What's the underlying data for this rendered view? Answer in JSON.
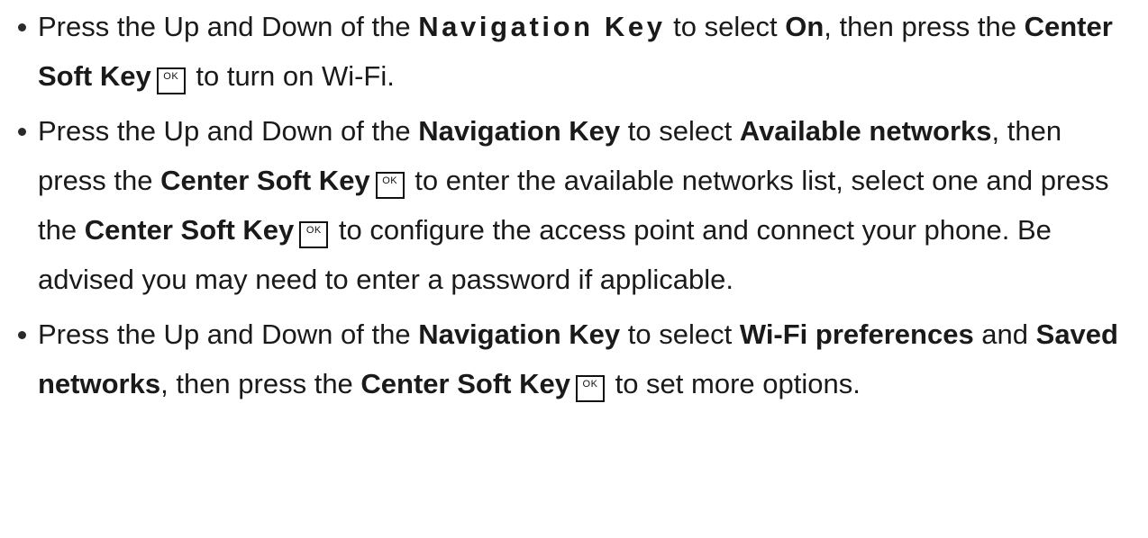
{
  "ok_key_label": "OK",
  "bullets": [
    {
      "p1": "Press the Up and Down of the ",
      "b1": "Navigation Key",
      "p2": " to select ",
      "b2": "On",
      "p3": ", then press the ",
      "b3": "Center Soft Key",
      "p4": " to turn on Wi-Fi."
    },
    {
      "p1": "Press the Up and Down of the ",
      "b1": "Navigation Key",
      "p2": " to select ",
      "b2": "Available networks",
      "p3": ", then press the ",
      "b3": "Center Soft Key",
      "p4": " to enter the available networks list, select one and press the ",
      "b4": "Center Soft Key",
      "p5": " to configure the access point and connect your phone. Be advised you may need to enter a password if applicable."
    },
    {
      "p1": "Press the Up and Down of the ",
      "b1": "Navigation Key",
      "p2": " to select ",
      "b2": "Wi-Fi preferences",
      "p3": " and ",
      "b3": "Saved networks",
      "p4": ", then press the ",
      "b4": "Center Soft Key",
      "p5": " to set more options."
    }
  ]
}
